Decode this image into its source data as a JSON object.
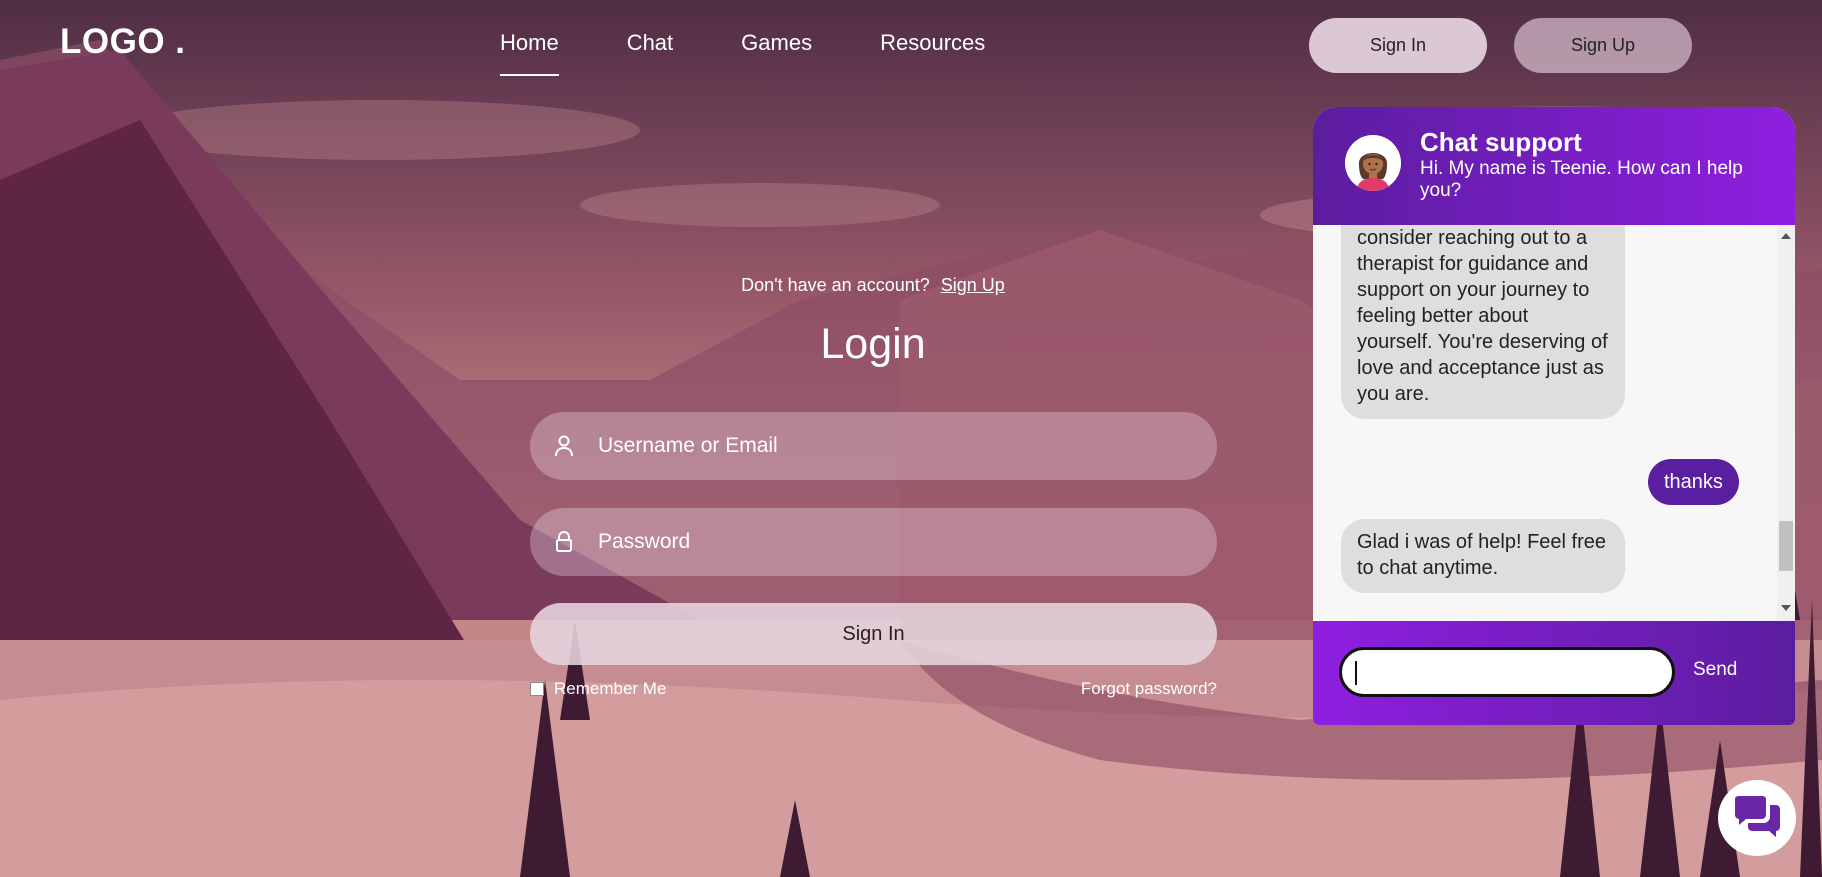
{
  "header": {
    "logo": "LOGO .",
    "nav": [
      {
        "label": "Home",
        "active": true
      },
      {
        "label": "Chat"
      },
      {
        "label": "Games"
      },
      {
        "label": "Resources"
      }
    ],
    "sign_in_label": "Sign In",
    "sign_up_label": "Sign Up"
  },
  "login": {
    "no_account_text": "Don't have an account?",
    "sign_up_link": "Sign Up",
    "title": "Login",
    "username_placeholder": "Username or Email",
    "password_placeholder": "Password",
    "submit_label": "Sign In",
    "remember_label": "Remember Me",
    "remember_checked": false,
    "forgot_label": "Forgot password?"
  },
  "chat": {
    "title": "Chat support",
    "subtitle": "Hi. My name is Teenie. How can I help you?",
    "messages": [
      {
        "from": "bot",
        "text": "consider reaching out to a therapist for guidance and support on your journey to feeling better about yourself. You're deserving of love and acceptance just as you are."
      },
      {
        "from": "user",
        "text": "thanks"
      },
      {
        "from": "bot",
        "text": "Glad i was of help! Feel free to chat anytime."
      }
    ],
    "input_value": "",
    "send_label": "Send",
    "colors": {
      "header_start": "#5b1d9f",
      "header_end": "#8f1fe0",
      "user_bubble": "#5a1fa0",
      "bot_bubble": "#dedede"
    }
  },
  "fab": {
    "icon": "chat-bubbles-icon"
  }
}
